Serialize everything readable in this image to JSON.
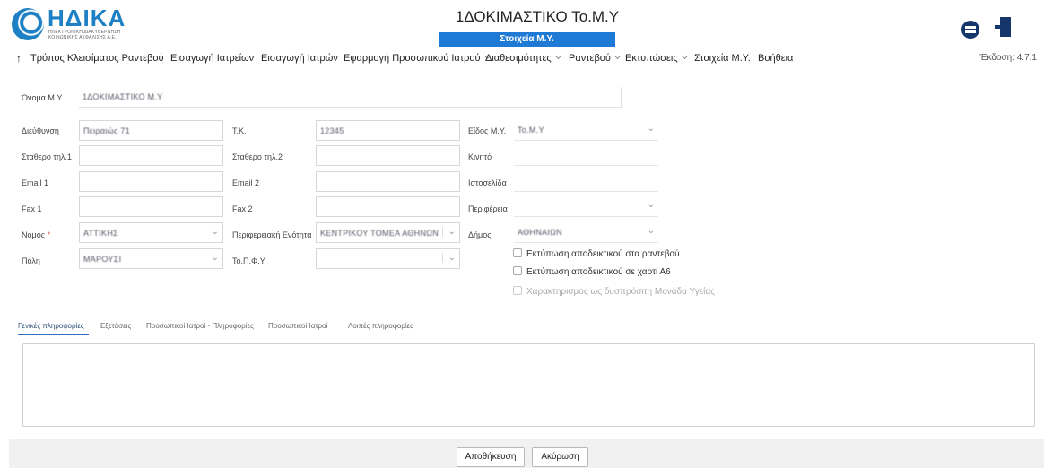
{
  "logo": {
    "name": "ΗΔΙΚΑ",
    "line1": "ΗΛΕΚΤΡΟΝΙΚΗ ΔΙΑΚΥΒΕΡΝΗΣΗ",
    "line2": "ΚΟΙΝΩΝΙΚΗΣ ΑΣΦΑΛΙΣΗΣ Α.Ε."
  },
  "header": {
    "title": "1ΔΟΚΙΜΑΣΤΙΚΟ Το.Μ.Υ",
    "section": "Στοιχεία Μ.Υ."
  },
  "nav": {
    "back": "↑",
    "items": [
      "Τρόπος Κλεισίματος Ραντεβού",
      "Εισαγωγή Ιατρείων",
      "Εισαγωγή Ιατρών",
      "Εφαρμογή Προσωπικού Ιατρού",
      "Διαθεσιμότητες",
      "Ραντεβού",
      "Εκτυπώσεις",
      "Στοιχεία Μ.Υ.",
      "Βοήθεια"
    ],
    "version": "Έκδοση: 4.7.1"
  },
  "form": {
    "name_label": "Όνομα Μ.Υ.",
    "name_value": "1ΔΟΚΙΜΑΣΤΙΚΟ Μ.Υ",
    "address_label": "Διεύθυνση",
    "address_value": "Πειραιώς 71",
    "tk_label": "Τ.Κ.",
    "tk_value": "12345",
    "type_label": "Είδος Μ.Υ.",
    "type_value": "Το.Μ.Υ",
    "phone1_label": "Σταθερο τηλ.1",
    "phone2_label": "Σταθερο τηλ.2",
    "mobile_label": "Κινητό",
    "email1_label": "Email 1",
    "email2_label": "Email 2",
    "website_label": "Ιστοσελίδα",
    "fax1_label": "Fax 1",
    "fax2_label": "Fax 2",
    "region_label": "Περιφέρεια",
    "prefecture_label": "Νομός",
    "prefecture_value": "ΑΤΤΙΚΗΣ",
    "regional_unit_label": "Περιφερειακή Ενότητα",
    "regional_unit_value": "ΚΕΝΤΡΙΚΟΥ ΤΟΜΕΑ ΑΘΗΝΩΝ",
    "municipality_label": "Δήμος",
    "municipality_value": "ΑΘΗΝΑΙΩΝ",
    "city_label": "Πόλη",
    "city_value": "ΜΑΡΟΥΣΙ",
    "topfy_label": "Το.Π.Φ.Υ",
    "check1": "Εκτύπωση αποδεικτικού στα ραντεβού",
    "check2": "Εκτύπωση αποδεικτικού σε χαρτί Α6",
    "check3": "Χαρακτηρισμος ως δυσπρόσιτη Μονάδα Υγείας"
  },
  "tabs": [
    "Γενικές πληροφορίες",
    "Εξετάσεις",
    "Προσωπικοί Ιατροί - Πληροφορίες",
    "Προσωπικοί Ιατροί",
    "Λοιπές πληροφορίες"
  ],
  "buttons": {
    "save": "Αποθήκευση",
    "cancel": "Ακύρωση"
  },
  "icons": {
    "dropdown": "chevron-down-icon",
    "switch": "switch-user-icon",
    "logout": "logout-icon"
  },
  "colors": {
    "brand": "#1d7fc4",
    "section_bar": "#1e7ad4",
    "icon": "#15366a",
    "required": "#d9534f"
  }
}
